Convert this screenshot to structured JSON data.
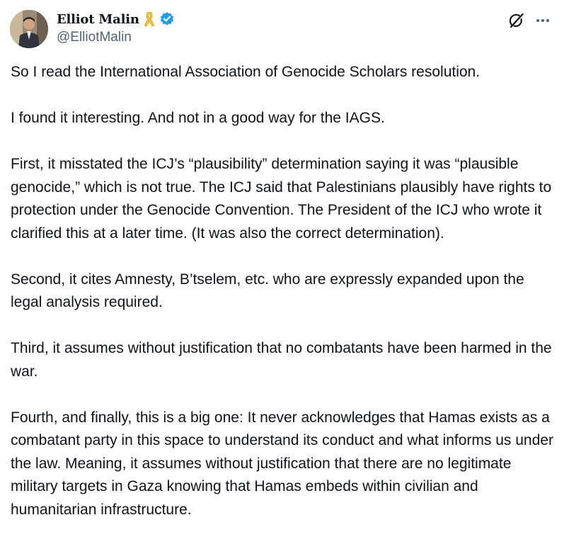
{
  "author": {
    "display_name": "Elliot Malin",
    "handle": "@ElliotMalin",
    "verified": true,
    "badges": [
      "yellow-ribbon-icon",
      "verified-badge-icon"
    ]
  },
  "actions": {
    "grok_icon": "grok-icon",
    "more_icon": "more-options-icon"
  },
  "colors": {
    "text": "#0f1419",
    "secondary_text": "#536471",
    "verified_blue": "#1d9bf0",
    "ribbon_yellow": "#f5c542"
  },
  "tweet": {
    "paragraphs": [
      "So I read the International Association of Genocide Scholars resolution.",
      "I found it interesting. And not in a good way for the IAGS.",
      "First, it misstated the ICJ’s “plausibility” determination saying it was “plausible genocide,” which is not true. The ICJ said that Palestinians plausibly have rights to protection under the Genocide Convention. The President of the ICJ who wrote it clarified this at a later time. (It was also the correct determination).",
      "Second, it cites Amnesty, B’tselem, etc. who are expressly expanded upon the legal analysis required.",
      "Third, it assumes without justification that no combatants have been harmed in the war.",
      "Fourth, and finally, this is a big one: It never acknowledges that Hamas exists as a combatant party in this space to understand its conduct and what informs us under the law. Meaning, it assumes without justification that there are no legitimate military targets in Gaza knowing that Hamas embeds within civilian and humanitarian infrastructure."
    ]
  }
}
